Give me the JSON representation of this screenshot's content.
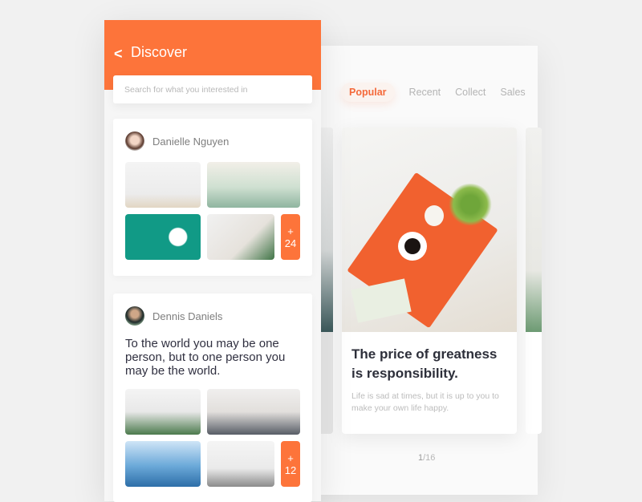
{
  "discover": {
    "back_label": "<",
    "title": "Discover",
    "search_placeholder": "Search for what you interested in",
    "posts": [
      {
        "user": "Danielle Nguyen",
        "quote": "",
        "more_plus": "+",
        "more_count": "24"
      },
      {
        "user": "Dennis Daniels",
        "quote": "To the world you may be one person, but to one person you may be the world.",
        "more_plus": "+",
        "more_count": "12"
      }
    ]
  },
  "feed": {
    "tabs": [
      {
        "label": "Popular",
        "active": true
      },
      {
        "label": "Recent",
        "active": false
      },
      {
        "label": "Collect",
        "active": false
      },
      {
        "label": "Sales",
        "active": false
      }
    ],
    "card": {
      "title": "The price of greatness is responsibility.",
      "description": "Life is sad at times, but it is up to you to make your own life happy."
    },
    "pager": {
      "current": "1",
      "total": "/16"
    }
  },
  "colors": {
    "accent": "#fd743a"
  }
}
